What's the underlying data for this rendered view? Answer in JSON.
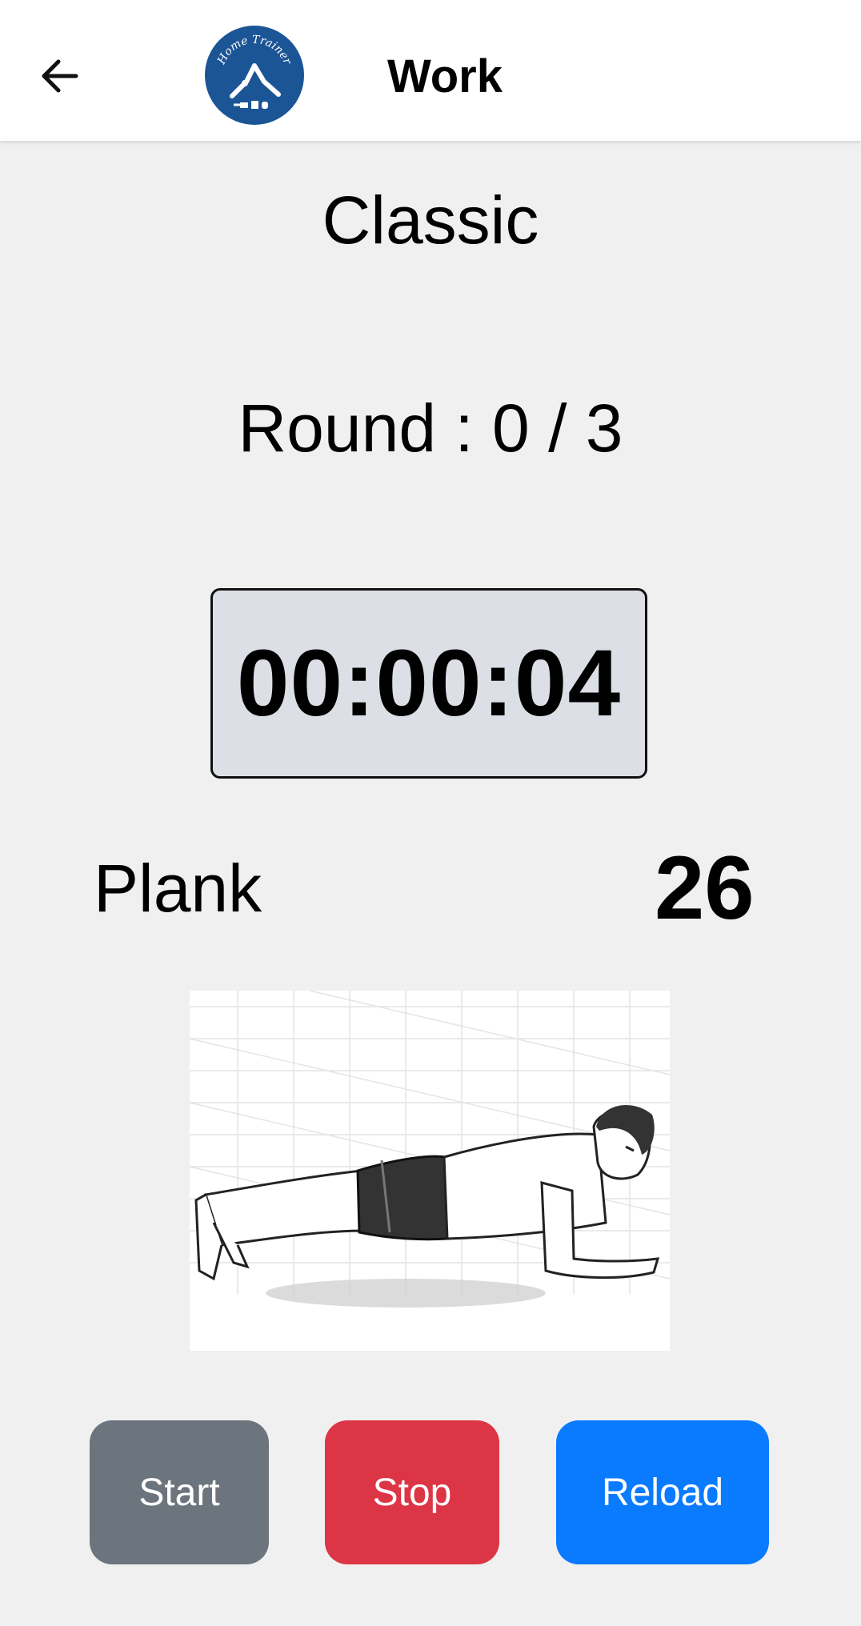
{
  "header": {
    "title": "Work",
    "logo_text": "Home Trainer",
    "back_icon": "arrow-left-icon"
  },
  "workout": {
    "name": "Classic",
    "round_text": "Round : 0 / 3",
    "timer": "00:00:04"
  },
  "exercise": {
    "name": "Plank",
    "count": "26",
    "image": "plank-illustration"
  },
  "buttons": {
    "start_label": "Start",
    "stop_label": "Stop",
    "reload_label": "Reload"
  },
  "colors": {
    "background": "#f0f0f0",
    "header_bg": "#ffffff",
    "logo_bg": "#1b5595",
    "timer_bg": "#dcdfe5",
    "start": "#6c757d",
    "stop": "#dc3545",
    "reload": "#0a7bff"
  }
}
